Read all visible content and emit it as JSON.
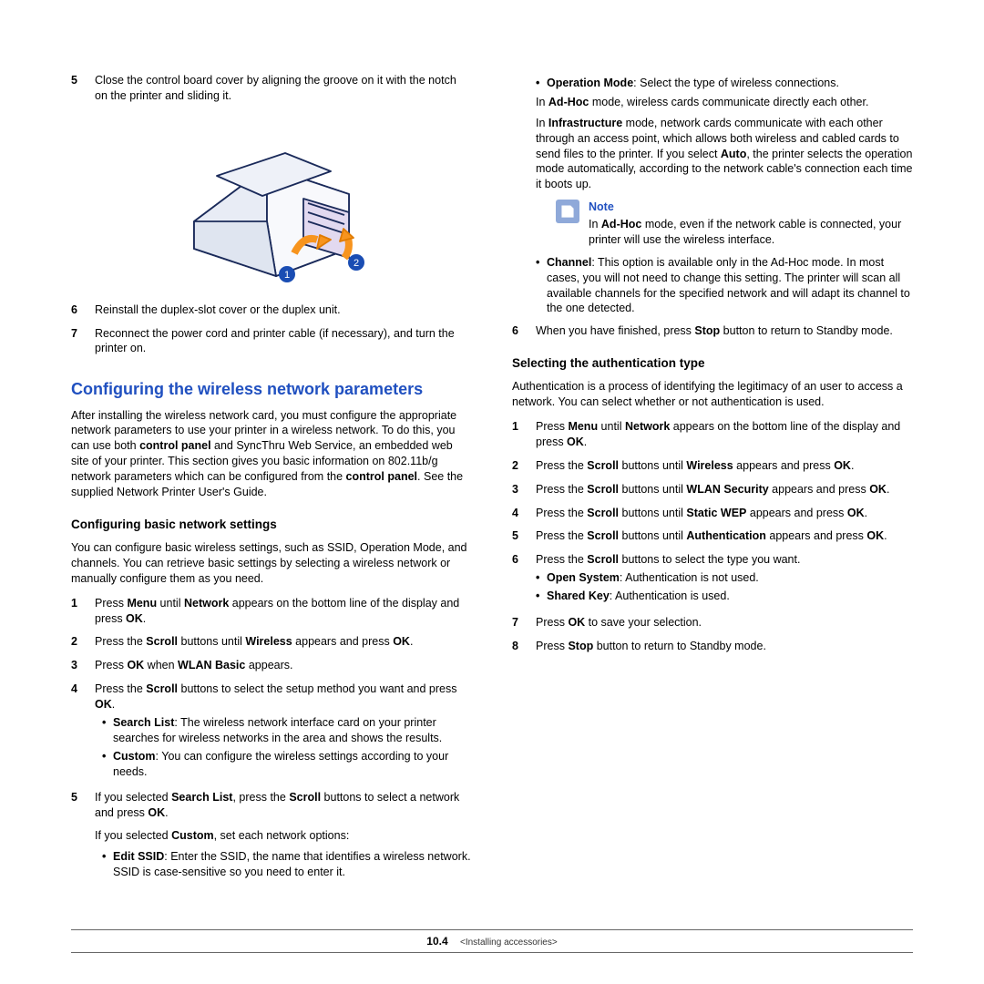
{
  "left": {
    "step5": "Close the control board cover by aligning the groove on it with the notch on the printer and sliding it.",
    "step6": "Reinstall the duplex-slot cover or the duplex unit.",
    "step7": "Reconnect the power cord and printer cable (if necessary), and turn the printer on.",
    "section_title": "Configuring the wireless network parameters",
    "section_intro_1": "After installing the wireless network card, you must configure the appropriate network parameters to use your printer in a wireless network. To do this, you can use both ",
    "section_intro_b1": "control panel",
    "section_intro_2": " and SyncThru Web Service, an embedded web site of your printer. This section gives you basic information on 802.11b/g network parameters which can be configured from the ",
    "section_intro_b2": "control panel",
    "section_intro_3": ". See the supplied Network Printer User's Guide.",
    "sub1": "Configuring basic network settings",
    "sub1_intro": "You can configure basic wireless settings, such as SSID, Operation Mode, and channels. You can retrieve basic settings by selecting a wireless network or manually configure them as you need.",
    "s1_1a": "Press ",
    "s1_1b": "Menu",
    "s1_1c": " until ",
    "s1_1d": "Network",
    "s1_1e": " appears on the bottom line of the display and press ",
    "s1_1f": "OK",
    "s1_1g": ".",
    "s1_2a": "Press the ",
    "s1_2b": "Scroll",
    "s1_2c": " buttons until ",
    "s1_2d": "Wireless",
    "s1_2e": " appears and press ",
    "s1_2f": "OK",
    "s1_2g": ".",
    "s1_3a": "Press ",
    "s1_3b": "OK",
    "s1_3c": " when ",
    "s1_3d": "WLAN Basic",
    "s1_3e": " appears.",
    "s1_4a": "Press the ",
    "s1_4b": "Scroll",
    "s1_4c": " buttons to select the setup method you want and press ",
    "s1_4d": "OK",
    "s1_4e": ".",
    "s1_4_b1a": "Search List",
    "s1_4_b1b": ": The wireless network interface card on your printer searches for wireless networks in the area and shows the results.",
    "s1_4_b2a": "Custom",
    "s1_4_b2b": ": You can configure the wireless settings according to your needs.",
    "s1_5a": "If you selected ",
    "s1_5b": "Search List",
    "s1_5c": ", press the ",
    "s1_5d": "Scroll",
    "s1_5e": " buttons to select a network and press ",
    "s1_5f": "OK",
    "s1_5g": ".",
    "s1_5_2a": "If you selected ",
    "s1_5_2b": "Custom",
    "s1_5_2c": ", set each network options:",
    "s1_5_b1a": "Edit SSID",
    "s1_5_b1b": ": Enter the SSID, the name that identifies a wireless network. SSID is case-sensitive so you need to enter it."
  },
  "right": {
    "b_opmode_a": "Operation Mode",
    "b_opmode_b": ": Select the type of wireless connections.",
    "adhoc_a": "In ",
    "adhoc_b": "Ad-Hoc",
    "adhoc_c": " mode, wireless cards communicate directly each other.",
    "infra_a": "In ",
    "infra_b": "Infrastructure",
    "infra_c": " mode, network cards communicate with each other through an access point, which allows both wireless and cabled cards to send files to the printer. If you select ",
    "infra_d": "Auto",
    "infra_e": ", the printer selects the operation mode automatically, according to the network cable's connection each time it boots up.",
    "note_title": "Note",
    "note_a": "In ",
    "note_b": "Ad-Hoc",
    "note_c": " mode, even if the network cable is connected, your printer will use the wireless interface.",
    "b_channel_a": "Channel",
    "b_channel_b": ": This option is available only in the Ad-Hoc mode. In most cases, you will not need to change this setting. The printer will scan all available channels for the specified network and will adapt its channel to the one detected.",
    "s6a": "When you have finished, press ",
    "s6b": "Stop",
    "s6c": " button to return to Standby mode.",
    "sub2": "Selecting the authentication type",
    "sub2_intro": "Authentication is a process of identifying the legitimacy of an user to access a network. You can select whether or not authentication is used.",
    "r1a": "Press ",
    "r1b": "Menu",
    "r1c": " until ",
    "r1d": "Network",
    "r1e": " appears on the bottom line of the display and press ",
    "r1f": "OK",
    "r1g": ".",
    "r2a": "Press the ",
    "r2b": "Scroll",
    "r2c": " buttons until ",
    "r2d": "Wireless",
    "r2e": " appears and press ",
    "r2f": "OK",
    "r2g": ".",
    "r3a": "Press the ",
    "r3b": "Scroll",
    "r3c": " buttons until ",
    "r3d": "WLAN Security",
    "r3e": " appears and press ",
    "r3f": "OK",
    "r3g": ".",
    "r4a": "Press the ",
    "r4b": "Scroll",
    "r4c": " buttons until ",
    "r4d": "Static WEP",
    "r4e": " appears and press ",
    "r4f": "OK",
    "r4g": ".",
    "r5a": "Press the ",
    "r5b": "Scroll",
    "r5c": " buttons until ",
    "r5d": "Authentication",
    "r5e": " appears and press ",
    "r5f": "OK",
    "r5g": ".",
    "r6a": "Press the ",
    "r6b": "Scroll",
    "r6c": " buttons to select the type you want.",
    "r6_b1a": "Open System",
    "r6_b1b": ": Authentication is not used.",
    "r6_b2a": "Shared Key",
    "r6_b2b": ": Authentication is used.",
    "r7a": "Press ",
    "r7b": "OK",
    "r7c": " to save your selection.",
    "r8a": "Press ",
    "r8b": "Stop",
    "r8c": " button to return to Standby mode."
  },
  "footer": {
    "page": "10.4",
    "chapter": "<Installing accessories>"
  }
}
